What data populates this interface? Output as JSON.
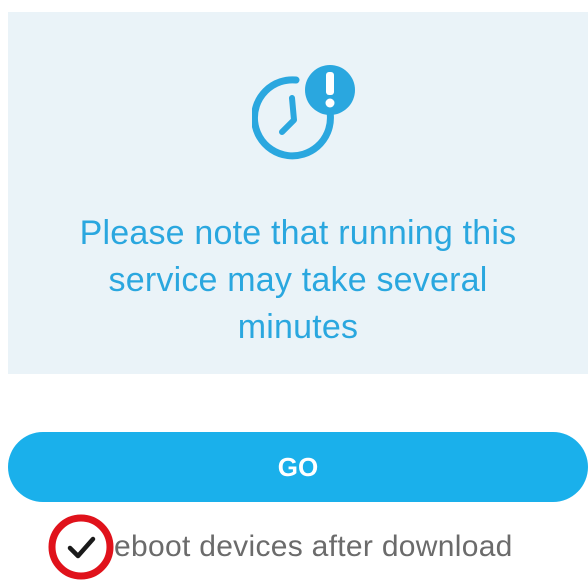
{
  "notice": {
    "icon": "clock-alert-icon",
    "message_line1": "Please note that running this",
    "message_line2": "service may take several",
    "message_line3": "minutes"
  },
  "go_button": {
    "label": "GO"
  },
  "reboot_option": {
    "checked": true,
    "label": "eboot devices after download",
    "checkbox_icon": "checkmark-icon",
    "highlight_color": "#e0121b"
  },
  "colors": {
    "accent": "#1ab0eb",
    "notice_text": "#2aa7df",
    "panel_bg": "#eaf3f8"
  }
}
